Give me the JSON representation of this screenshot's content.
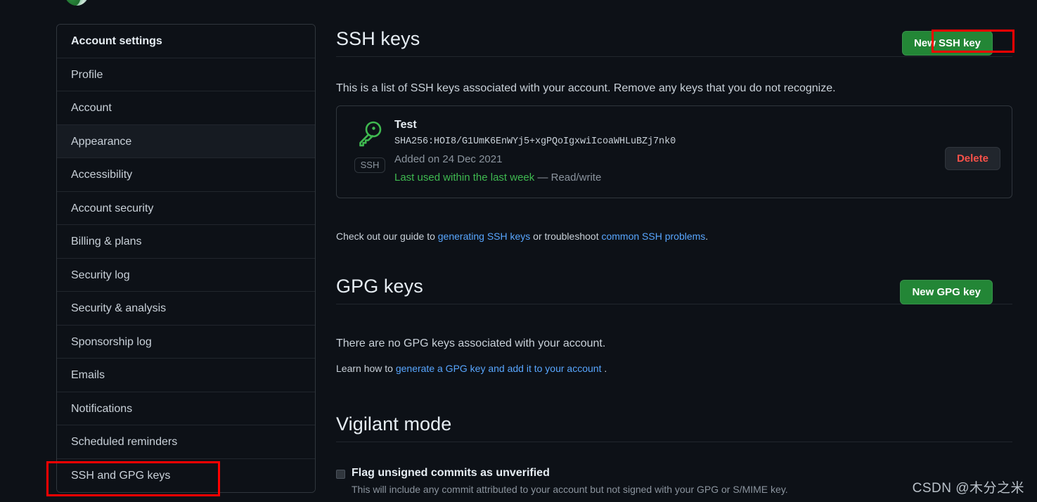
{
  "sidebar": {
    "items": [
      {
        "label": "Account settings",
        "heading": true,
        "hover": false
      },
      {
        "label": "Profile",
        "heading": false,
        "hover": false
      },
      {
        "label": "Account",
        "heading": false,
        "hover": false
      },
      {
        "label": "Appearance",
        "heading": false,
        "hover": true
      },
      {
        "label": "Accessibility",
        "heading": false,
        "hover": false
      },
      {
        "label": "Account security",
        "heading": false,
        "hover": false
      },
      {
        "label": "Billing & plans",
        "heading": false,
        "hover": false
      },
      {
        "label": "Security log",
        "heading": false,
        "hover": false
      },
      {
        "label": "Security & analysis",
        "heading": false,
        "hover": false
      },
      {
        "label": "Sponsorship log",
        "heading": false,
        "hover": false
      },
      {
        "label": "Emails",
        "heading": false,
        "hover": false
      },
      {
        "label": "Notifications",
        "heading": false,
        "hover": false
      },
      {
        "label": "Scheduled reminders",
        "heading": false,
        "hover": false
      },
      {
        "label": "SSH and GPG keys",
        "heading": false,
        "hover": false
      }
    ]
  },
  "ssh_section": {
    "title": "SSH keys",
    "new_key_button": "New SSH key",
    "description": "This is a list of SSH keys associated with your account. Remove any keys that you do not recognize.",
    "key": {
      "name": "Test",
      "fingerprint": "SHA256:HOI8/G1UmK6EnWYj5+xgPQoIgxwiIcoaWHLuBZj7nk0",
      "added": "Added on 24 Dec 2021",
      "last_used": "Last used within the last week",
      "access": "— Read/write",
      "badge": "SSH",
      "delete_button": "Delete"
    },
    "guide_prefix": "Check out our guide to ",
    "guide_link1": "generating SSH keys",
    "guide_middle": " or troubleshoot ",
    "guide_link2": "common SSH problems",
    "guide_suffix": "."
  },
  "gpg_section": {
    "title": "GPG keys",
    "new_key_button": "New GPG key",
    "empty_message": "There are no GPG keys associated with your account.",
    "learn_prefix": "Learn how to ",
    "learn_link": "generate a GPG key and add it to your account",
    "learn_suffix": " ."
  },
  "vigilant_section": {
    "title": "Vigilant mode",
    "checkbox_label": "Flag unsigned commits as unverified",
    "checkbox_description": "This will include any commit attributed to your account but not signed with your GPG or S/MIME key.",
    "checkbox_checked": false
  },
  "watermark": "CSDN @木分之米",
  "colors": {
    "background": "#0d1117",
    "border": "#30363d",
    "accent_green": "#238636",
    "link_blue": "#58a6ff",
    "danger_red": "#f85149",
    "annotation_red": "#ff0000",
    "success_green": "#3fb950"
  }
}
